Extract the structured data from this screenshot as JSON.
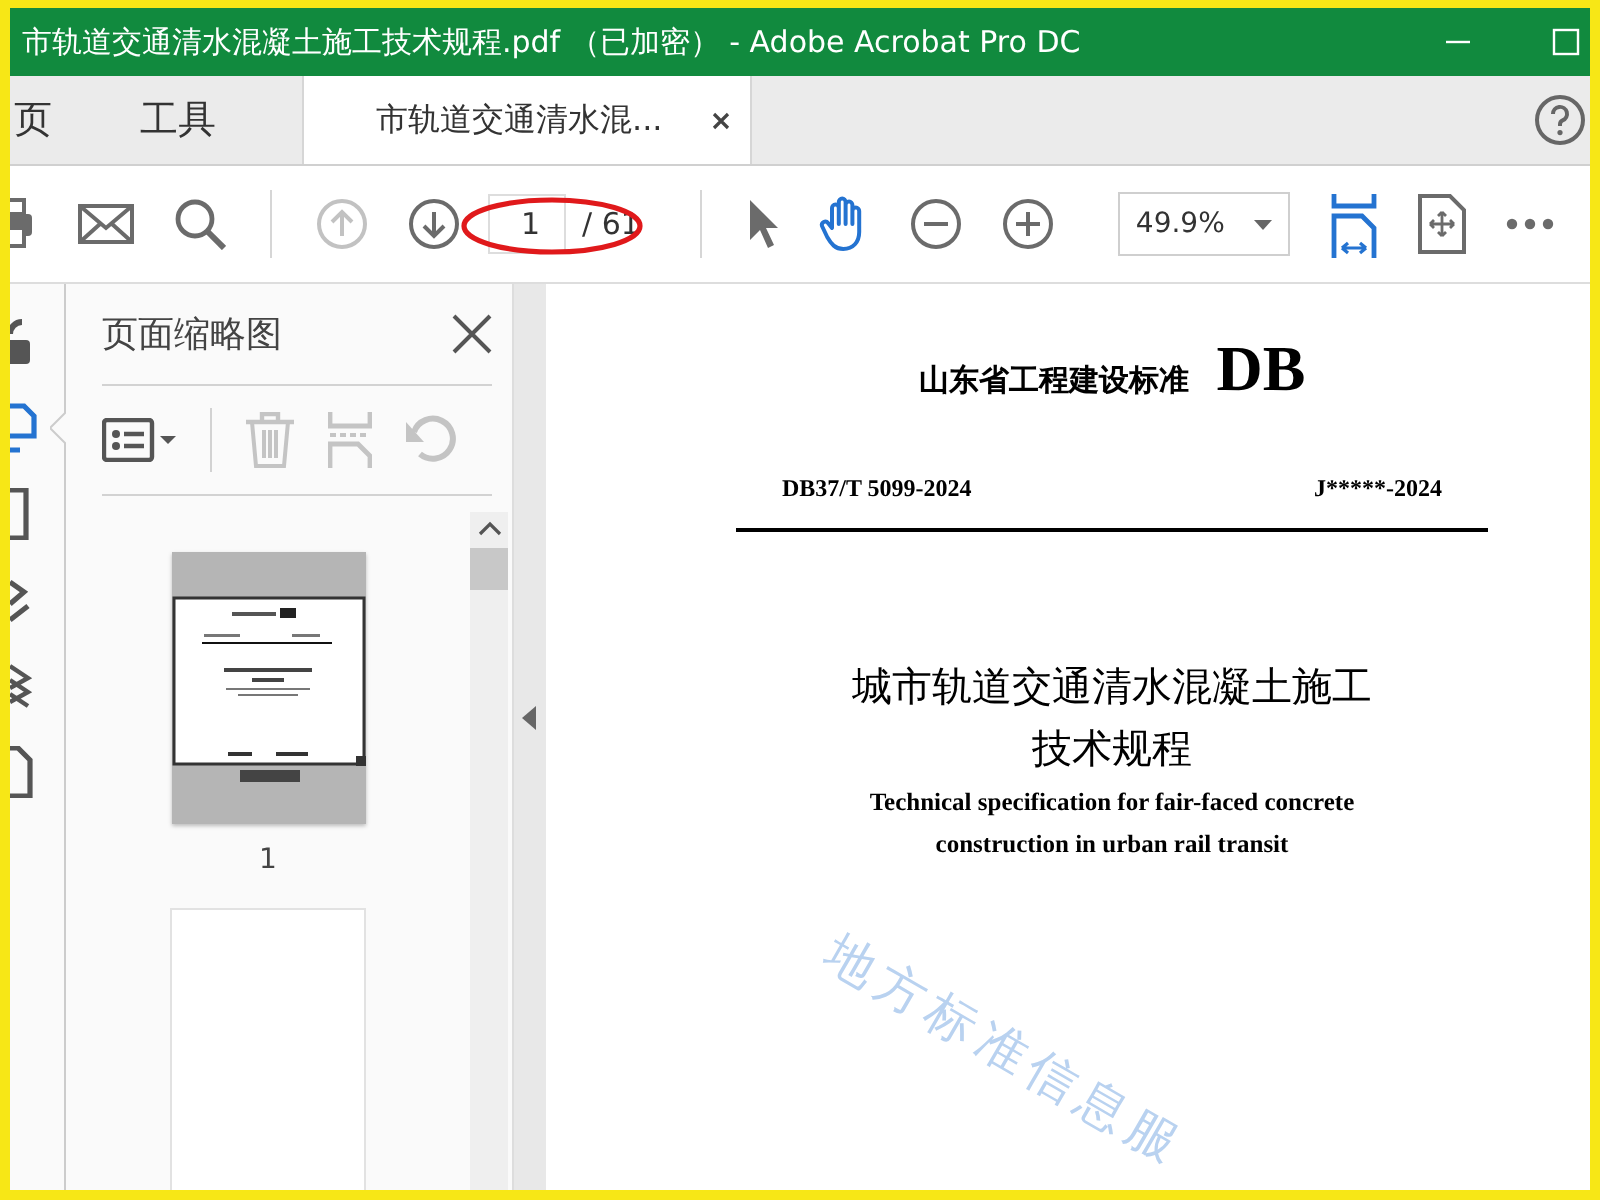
{
  "window": {
    "title": "市轨道交通清水混凝土施工技术规程.pdf （已加密） - Adobe Acrobat Pro DC"
  },
  "tabs": [
    {
      "label": "页",
      "kind": "home",
      "selected": false
    },
    {
      "label": "工具",
      "kind": "tools",
      "selected": false
    },
    {
      "label": "市轨道交通清水混...",
      "kind": "document",
      "selected": true
    }
  ],
  "toolbar": {
    "left_tools": [
      {
        "kind": "print",
        "disabled": false
      },
      {
        "kind": "mail",
        "disabled": false
      },
      {
        "kind": "search",
        "disabled": false
      },
      {
        "kind": "prev-page",
        "disabled": true
      },
      {
        "kind": "next-page",
        "disabled": false
      }
    ],
    "page_number": "1",
    "page_total": "/ 61",
    "mode_tools": [
      {
        "kind": "select",
        "selected": false
      },
      {
        "kind": "hand",
        "selected": true
      },
      {
        "kind": "zoom-out",
        "selected": false
      },
      {
        "kind": "zoom-in",
        "selected": false
      }
    ],
    "zoom": "49.9%",
    "view_tools": [
      {
        "kind": "fit-width",
        "selected": true
      },
      {
        "kind": "fit-page",
        "selected": false
      },
      {
        "kind": "more",
        "selected": false
      }
    ]
  },
  "side_strip": [
    {
      "kind": "lock",
      "selected": false
    },
    {
      "kind": "thumbnails",
      "selected": true
    },
    {
      "kind": "bookmark",
      "selected": false
    },
    {
      "kind": "sign",
      "selected": false
    },
    {
      "kind": "layers",
      "selected": false
    },
    {
      "kind": "attachment",
      "selected": false
    }
  ],
  "panel": {
    "title": "页面缩略图",
    "tools": [
      {
        "kind": "options",
        "disabled": false
      },
      {
        "kind": "delete",
        "disabled": true
      },
      {
        "kind": "extract",
        "disabled": true
      },
      {
        "kind": "rotate",
        "disabled": true
      }
    ],
    "thumbnails": [
      {
        "label": "1",
        "selected": true
      },
      {
        "selected": false
      }
    ]
  },
  "document": {
    "issuer": "山东省工程建设标准",
    "code": "DB",
    "standard_number": "DB37/T 5099-2024",
    "record_number": "J*****-2024",
    "title_lines": [
      "城市轨道交通清水混凝土施工",
      "技术规程"
    ],
    "english_lines": [
      "Technical specification for fair-faced concrete",
      "construction in urban rail transit"
    ],
    "stamp": "地方标准信息服"
  }
}
